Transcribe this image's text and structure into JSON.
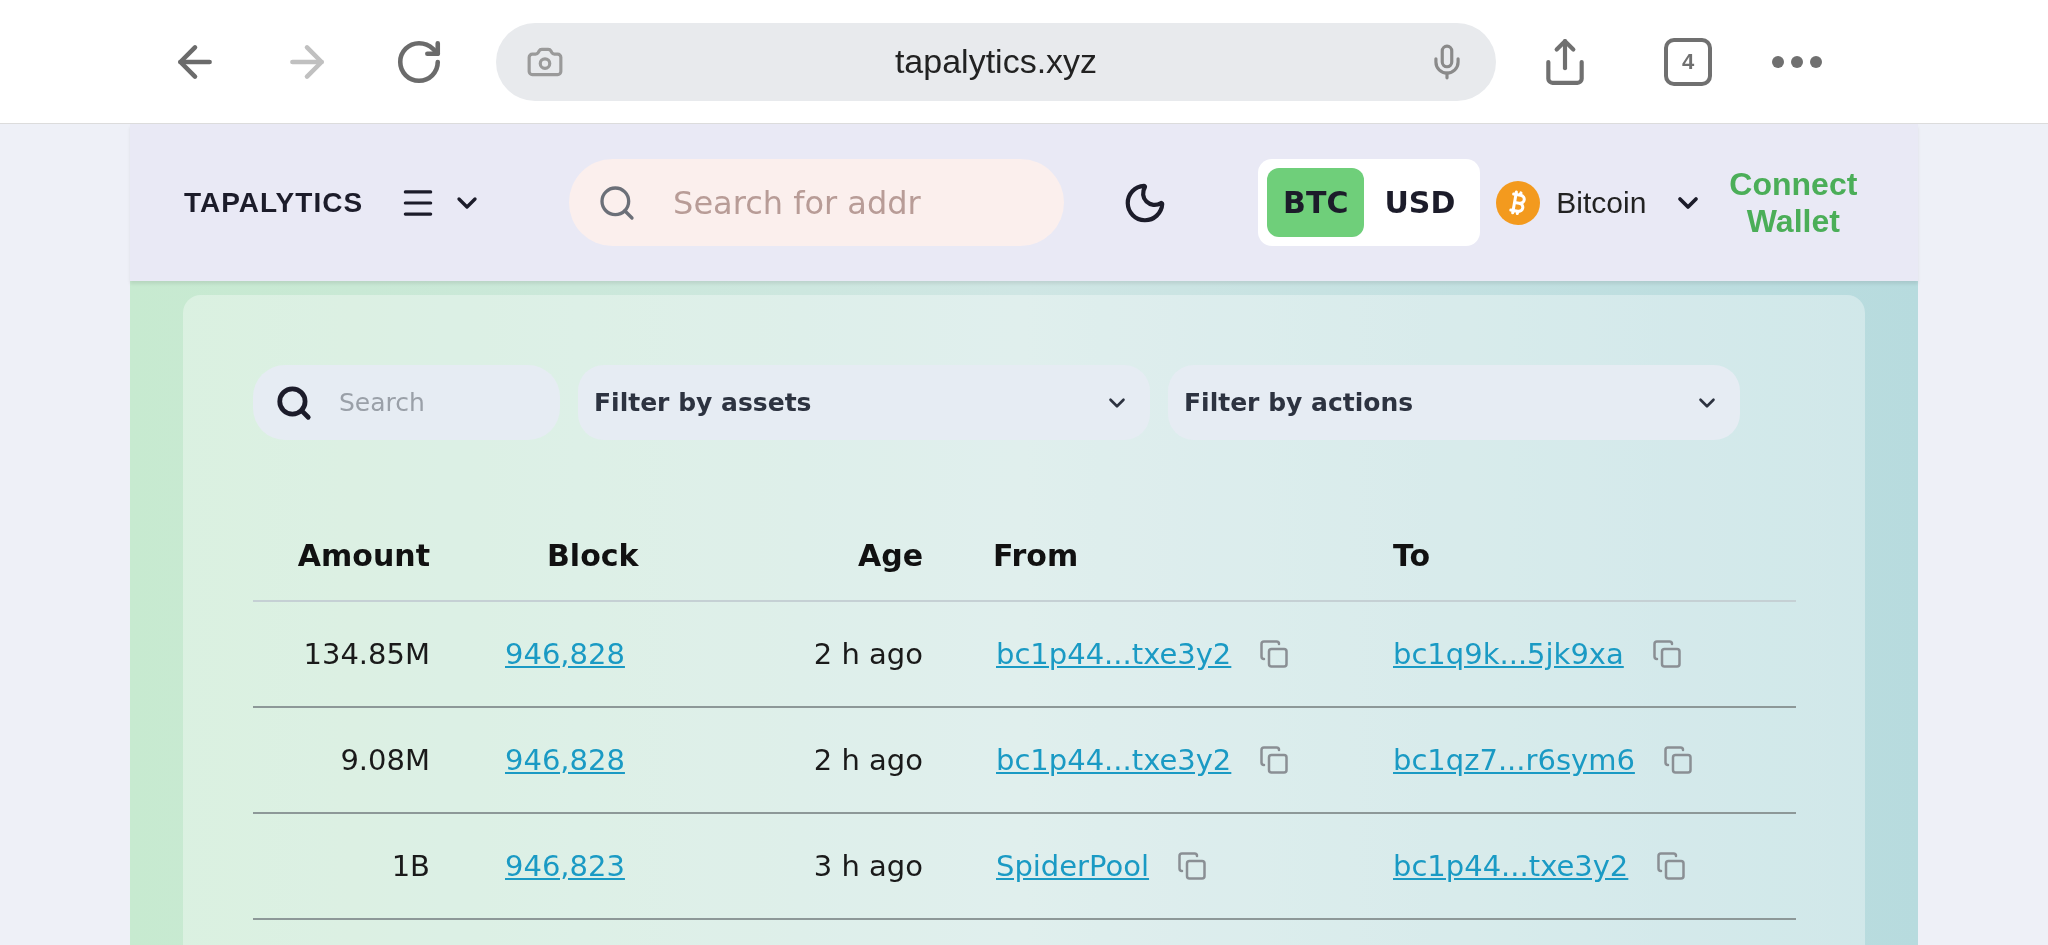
{
  "browser": {
    "back": {
      "disabled": false
    },
    "forward": {
      "disabled": true
    },
    "url": "tapalytics.xyz",
    "tab_count": "4"
  },
  "header": {
    "logo": "TAPALYTICS",
    "search": {
      "placeholder": "Search for addr"
    },
    "currency_toggle": [
      {
        "label": "BTC",
        "selected": true
      },
      {
        "label": "USD",
        "selected": false
      }
    ],
    "network": "Bitcoin",
    "connect_wallet": "Connect Wallet"
  },
  "filters": {
    "search": {
      "placeholder": "Search"
    },
    "dropdowns": [
      "Filter by assets",
      "Filter by actions"
    ]
  },
  "table": {
    "columns": [
      "Amount",
      "Block",
      "Age",
      "From",
      "To"
    ],
    "rows": [
      {
        "amount": "134.85M",
        "block": "946,828",
        "age": "2 h ago",
        "from": "bc1p44...txe3y2",
        "to": "bc1q9k...5jk9xa"
      },
      {
        "amount": "9.08M",
        "block": "946,828",
        "age": "2 h ago",
        "from": "bc1p44...txe3y2",
        "to": "bc1qz7...r6sym6"
      },
      {
        "amount": "1B",
        "block": "946,823",
        "age": "3 h ago",
        "from": "SpiderPool",
        "to": "bc1p44...txe3y2"
      }
    ]
  }
}
